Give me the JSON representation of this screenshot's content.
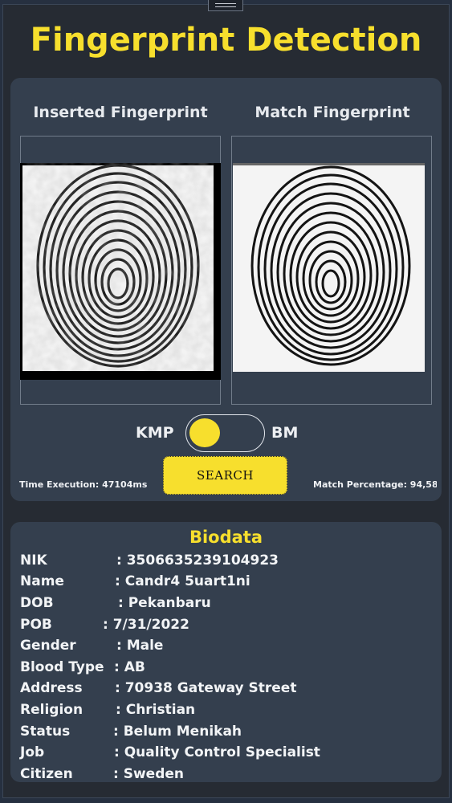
{
  "app": {
    "title": "Fingerprint Detection"
  },
  "fingerprints": {
    "inserted_label": "Inserted Fingerprint",
    "match_label": "Match Fingerprint"
  },
  "controls": {
    "algo_left": "KMP",
    "algo_right": "BM",
    "toggle_selected": "KMP",
    "search_label": "SEARCH",
    "time_execution": "Time Execution: 47104ms",
    "match_percentage": "Match Percentage: 94,58"
  },
  "biodata": {
    "title": "Biodata",
    "rows": [
      {
        "key": "NIK",
        "value": ": 3506635239104923"
      },
      {
        "key": "Name",
        "value": ": Candr4 5uart1ni"
      },
      {
        "key": "DOB",
        "value": ":  Pekanbaru"
      },
      {
        "key": "POB",
        "value": ": 7/31/2022"
      },
      {
        "key": "Gender",
        "value": ": Male"
      },
      {
        "key": "Blood Type",
        "value": ": AB"
      },
      {
        "key": "Address",
        "value": ": 70938 Gateway Street"
      },
      {
        "key": "Religion",
        "value": ": Christian"
      },
      {
        "key": "Status",
        "value": ": Belum Menikah"
      },
      {
        "key": "Job",
        "value": ": Quality Control Specialist"
      },
      {
        "key": "Citizen",
        "value": ": Sweden"
      }
    ]
  },
  "colors": {
    "accent": "#f7df2d",
    "panel": "#343f4e",
    "background": "#262b33"
  }
}
